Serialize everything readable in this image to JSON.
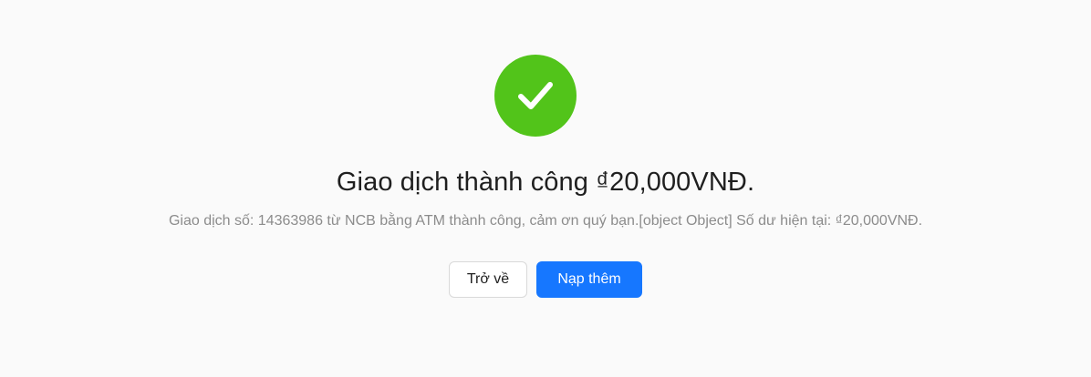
{
  "result": {
    "status": "success",
    "icon": "check-circle-icon",
    "colors": {
      "success": "#52c41a",
      "primary": "#1677ff",
      "title": "#1f1f1f",
      "subtitle": "#8c8c8c",
      "background": "#fafafa"
    },
    "title": "Giao dịch thành công ₫20,000VNĐ.",
    "subtitle": "Giao dịch số: 14363986 từ NCB bằng ATM thành công, cảm ơn quý bạn.[object Object] Số dư hiện tại: ₫20,000VNĐ.",
    "actions": {
      "back_label": "Trở về",
      "topup_label": "Nạp thêm"
    }
  }
}
